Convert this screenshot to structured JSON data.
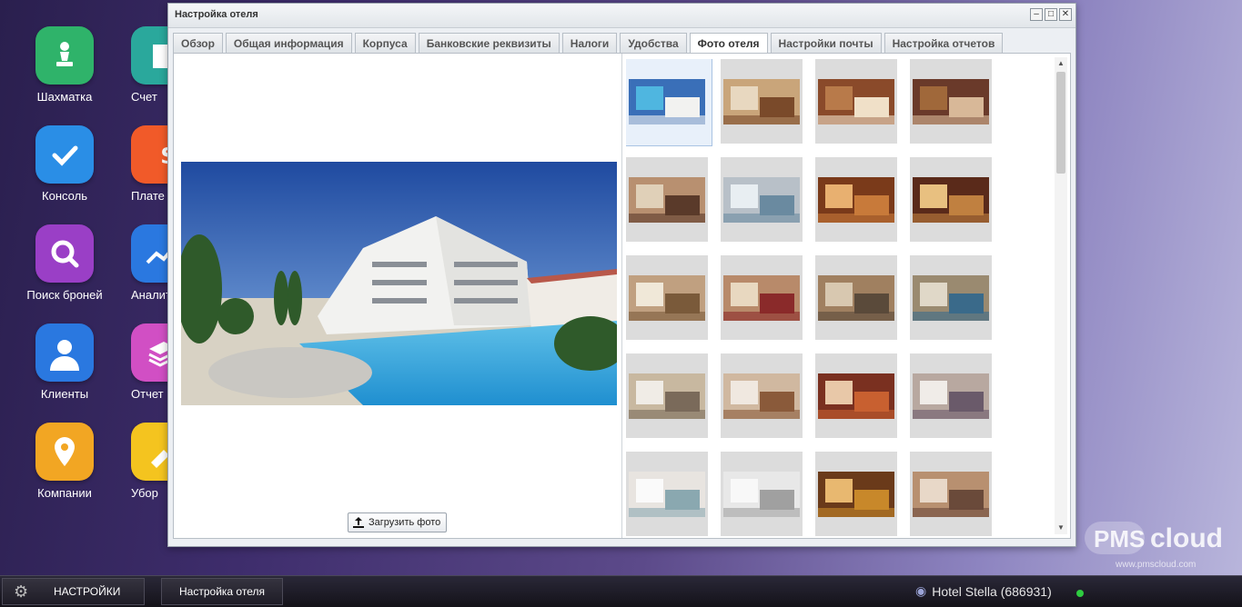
{
  "desktop": {
    "icons": [
      {
        "label": "Шахматка",
        "color": "#2fb36a"
      },
      {
        "label": "Консоль",
        "color": "#2a8ee6"
      },
      {
        "label": "Поиск броней",
        "color": "#9a3fc6"
      },
      {
        "label": "Клиенты",
        "color": "#2a78e0"
      },
      {
        "label": "Компании",
        "color": "#f2a623"
      }
    ],
    "clipped_icons": [
      {
        "label": "Счет",
        "color": "#2aa89c"
      },
      {
        "label": "Плате",
        "color": "#f15a29"
      },
      {
        "label": "Аналит",
        "color": "#2a78e0"
      },
      {
        "label": "Отчет",
        "color": "#d14fc4"
      },
      {
        "label": "Убор",
        "color": "#f4c41f"
      }
    ]
  },
  "window": {
    "title": "Настройка отеля",
    "tabs": [
      {
        "label": "Обзор",
        "active": false
      },
      {
        "label": "Общая информация",
        "active": false
      },
      {
        "label": "Корпуса",
        "active": false
      },
      {
        "label": "Банковские реквизиты",
        "active": false
      },
      {
        "label": "Налоги",
        "active": false
      },
      {
        "label": "Удобства",
        "active": false
      },
      {
        "label": "Фото отеля",
        "active": true
      },
      {
        "label": "Настройки почты",
        "active": false
      },
      {
        "label": "Настройка отчетов",
        "active": false
      }
    ],
    "upload_label": "Загрузить фото"
  },
  "taskbar": {
    "settings_label": "НАСТРОЙКИ",
    "open_window": "Настройка отеля",
    "hotel": "Hotel Stella (686931)"
  },
  "branding": {
    "logo": "PMS cloud",
    "url": "www.pmscloud.com"
  }
}
